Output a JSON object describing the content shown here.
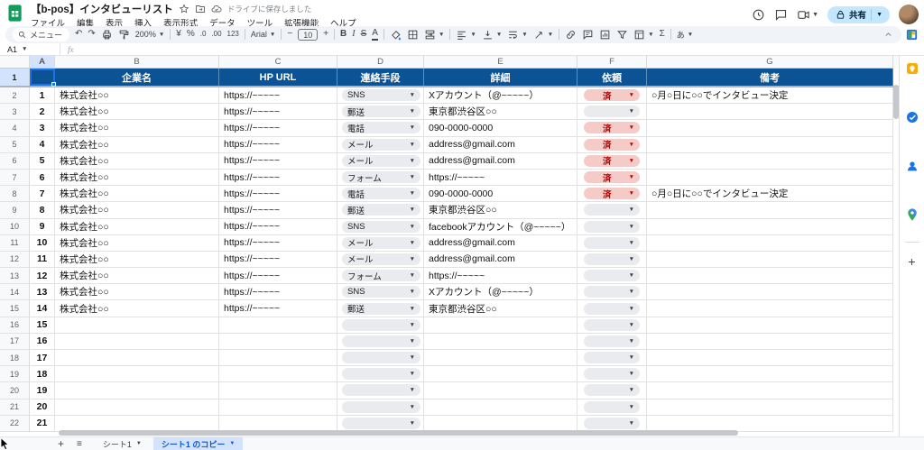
{
  "app": {
    "title": "【b-pos】インタビューリスト",
    "saved_status": "ドライブに保存しました",
    "menus": [
      "ファイル",
      "編集",
      "表示",
      "挿入",
      "表示形式",
      "データ",
      "ツール",
      "拡張機能",
      "ヘルプ"
    ],
    "share_label": "共有"
  },
  "toolbar": {
    "menus_label": "メニュー",
    "undo": "↶",
    "redo": "↷",
    "zoom_level": "200%",
    "currency": "¥",
    "percent": "%",
    "decrease_decimal": ".0",
    "increase_decimal": ".00",
    "number_format": "123",
    "font_name": "Arial",
    "decrease_font": "−",
    "font_size": "10",
    "increase_font": "+",
    "bold": "B",
    "italic": "I",
    "strikethrough": "S",
    "text_color": "A",
    "sum": "Σ",
    "input_tools": "あ"
  },
  "formula_bar": {
    "name_box": "A1",
    "fx": "fx"
  },
  "grid": {
    "column_letters": [
      "A",
      "B",
      "C",
      "D",
      "E",
      "F",
      "G"
    ],
    "header_row": {
      "row_number": "1",
      "labels": [
        "企業名",
        "HP URL",
        "連絡手段",
        "詳細",
        "依頼",
        "備考"
      ]
    },
    "rows": [
      {
        "row": "2",
        "no": "1",
        "company": "株式会社○○",
        "url": "https://~~~~~",
        "method": "SNS",
        "detail": "Xアカウント（@~~~~~）",
        "status": "済",
        "note": "○月○日に○○でインタビュー決定"
      },
      {
        "row": "3",
        "no": "2",
        "company": "株式会社○○",
        "url": "https://~~~~~",
        "method": "郵送",
        "detail": "東京都渋谷区○○",
        "status": "",
        "note": ""
      },
      {
        "row": "4",
        "no": "3",
        "company": "株式会社○○",
        "url": "https://~~~~~",
        "method": "電話",
        "detail": "090-0000-0000",
        "status": "済",
        "note": ""
      },
      {
        "row": "5",
        "no": "4",
        "company": "株式会社○○",
        "url": "https://~~~~~",
        "method": "メール",
        "detail": "address@gmail.com",
        "status": "済",
        "note": ""
      },
      {
        "row": "6",
        "no": "5",
        "company": "株式会社○○",
        "url": "https://~~~~~",
        "method": "メール",
        "detail": "address@gmail.com",
        "status": "済",
        "note": ""
      },
      {
        "row": "7",
        "no": "6",
        "company": "株式会社○○",
        "url": "https://~~~~~",
        "method": "フォーム",
        "detail": "https://~~~~~",
        "status": "済",
        "note": ""
      },
      {
        "row": "8",
        "no": "7",
        "company": "株式会社○○",
        "url": "https://~~~~~",
        "method": "電話",
        "detail": "090-0000-0000",
        "status": "済",
        "note": "○月○日に○○でインタビュー決定"
      },
      {
        "row": "9",
        "no": "8",
        "company": "株式会社○○",
        "url": "https://~~~~~",
        "method": "郵送",
        "detail": "東京都渋谷区○○",
        "status": "",
        "note": ""
      },
      {
        "row": "10",
        "no": "9",
        "company": "株式会社○○",
        "url": "https://~~~~~",
        "method": "SNS",
        "detail": "facebookアカウント（@~~~~~）",
        "status": "",
        "note": ""
      },
      {
        "row": "11",
        "no": "10",
        "company": "株式会社○○",
        "url": "https://~~~~~",
        "method": "メール",
        "detail": "address@gmail.com",
        "status": "",
        "note": ""
      },
      {
        "row": "12",
        "no": "11",
        "company": "株式会社○○",
        "url": "https://~~~~~",
        "method": "メール",
        "detail": "address@gmail.com",
        "status": "",
        "note": ""
      },
      {
        "row": "13",
        "no": "12",
        "company": "株式会社○○",
        "url": "https://~~~~~",
        "method": "フォーム",
        "detail": "https://~~~~~",
        "status": "",
        "note": ""
      },
      {
        "row": "14",
        "no": "13",
        "company": "株式会社○○",
        "url": "https://~~~~~",
        "method": "SNS",
        "detail": "Xアカウント（@~~~~~）",
        "status": "",
        "note": ""
      },
      {
        "row": "15",
        "no": "14",
        "company": "株式会社○○",
        "url": "https://~~~~~",
        "method": "郵送",
        "detail": "東京都渋谷区○○",
        "status": "",
        "note": ""
      },
      {
        "row": "16",
        "no": "15",
        "company": "",
        "url": "",
        "method": "",
        "detail": "",
        "status": "",
        "note": ""
      },
      {
        "row": "17",
        "no": "16",
        "company": "",
        "url": "",
        "method": "",
        "detail": "",
        "status": "",
        "note": ""
      },
      {
        "row": "18",
        "no": "17",
        "company": "",
        "url": "",
        "method": "",
        "detail": "",
        "status": "",
        "note": ""
      },
      {
        "row": "19",
        "no": "18",
        "company": "",
        "url": "",
        "method": "",
        "detail": "",
        "status": "",
        "note": ""
      },
      {
        "row": "20",
        "no": "19",
        "company": "",
        "url": "",
        "method": "",
        "detail": "",
        "status": "",
        "note": ""
      },
      {
        "row": "21",
        "no": "20",
        "company": "",
        "url": "",
        "method": "",
        "detail": "",
        "status": "",
        "note": ""
      },
      {
        "row": "22",
        "no": "21",
        "company": "",
        "url": "",
        "method": "",
        "detail": "",
        "status": "",
        "note": ""
      }
    ],
    "status_done_label": "済"
  },
  "footer": {
    "sheet_tabs": [
      {
        "label": "シート1",
        "active": false
      },
      {
        "label": "シート1 のコピー",
        "active": true
      }
    ]
  },
  "colors": {
    "header_blue": "#0b5394",
    "done_chip_bg": "#f5cbc7",
    "done_chip_text": "#b10202",
    "empty_chip_bg": "#e9ebee",
    "active_tab_bg": "#d3e3fd",
    "active_tab_text": "#0b57d0",
    "share_button_bg": "#c2e7ff",
    "sheets_green": "#0f9d58",
    "selection_blue": "#1a73e8"
  }
}
